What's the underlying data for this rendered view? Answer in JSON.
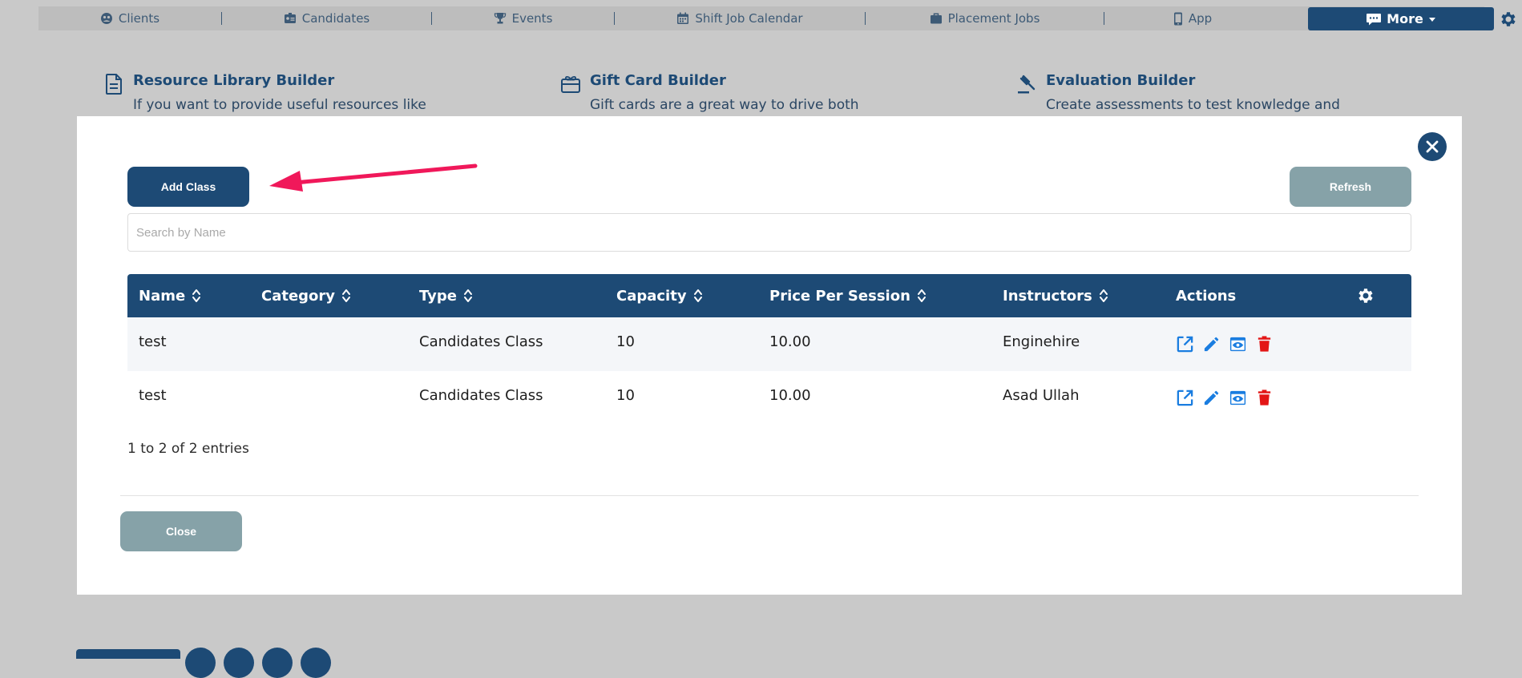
{
  "nav": {
    "items": [
      {
        "label": "Clients",
        "icon": "clients-icon"
      },
      {
        "label": "Candidates",
        "icon": "id-badge-icon"
      },
      {
        "label": "Events",
        "icon": "trophy-icon"
      },
      {
        "label": "Shift Job Calendar",
        "icon": "calendar-icon"
      },
      {
        "label": "Placement Jobs",
        "icon": "briefcase-icon"
      },
      {
        "label": "App",
        "icon": "phone-icon"
      }
    ],
    "more_label": "More"
  },
  "builders": [
    {
      "title": "Resource Library Builder",
      "desc": "If you want to provide useful resources like",
      "icon": "document-icon"
    },
    {
      "title": "Gift Card Builder",
      "desc": "Gift cards are a great way to drive both",
      "icon": "gift-card-icon"
    },
    {
      "title": "Evaluation Builder",
      "desc": "Create assessments to test knowledge and",
      "icon": "gavel-icon"
    }
  ],
  "modal": {
    "add_label": "Add Class",
    "refresh_label": "Refresh",
    "close_label": "Close",
    "search_placeholder": "Search by Name",
    "entries_text": "1 to 2 of 2 entries",
    "columns": [
      "Name",
      "Category",
      "Type",
      "Capacity",
      "Price Per Session",
      "Instructors",
      "Actions"
    ],
    "rows": [
      {
        "name": "test",
        "category": "",
        "type": "Candidates Class",
        "capacity": "10",
        "price": "10.00",
        "instructors": "Enginehire"
      },
      {
        "name": "test",
        "category": "",
        "type": "Candidates Class",
        "capacity": "10",
        "price": "10.00",
        "instructors": "Asad Ullah"
      }
    ]
  },
  "colors": {
    "primary": "#1d4a75",
    "muted_button": "#86a2a8",
    "action_blue": "#1a7de0",
    "action_red": "#e31616",
    "annotation_arrow": "#f0185a"
  }
}
